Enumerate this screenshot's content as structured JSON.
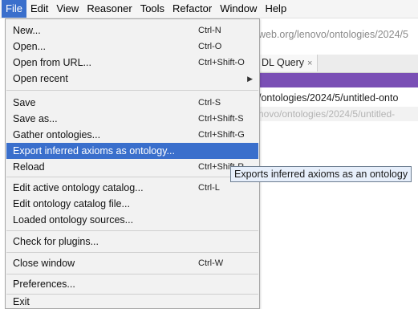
{
  "menubar": {
    "items": [
      "File",
      "Edit",
      "View",
      "Reasoner",
      "Tools",
      "Refactor",
      "Window",
      "Help"
    ]
  },
  "background": {
    "url_fragment": "web.org/lenovo/ontologies/2024/5",
    "tab_label": "DL Query",
    "tab_close": "×",
    "iri_text": "/ontologies/2024/5/untitled-onto",
    "iri_text_faded": "novo/ontologies/2024/5/untitled-"
  },
  "file_menu": {
    "new": {
      "label": "New...",
      "acc": "Ctrl-N"
    },
    "open": {
      "label": "Open...",
      "acc": "Ctrl-O"
    },
    "open_url": {
      "label": "Open from URL...",
      "acc": "Ctrl+Shift-O"
    },
    "open_recent": {
      "label": "Open recent"
    },
    "save": {
      "label": "Save",
      "acc": "Ctrl-S"
    },
    "save_as": {
      "label": "Save as...",
      "acc": "Ctrl+Shift-S"
    },
    "gather": {
      "label": "Gather ontologies...",
      "acc": "Ctrl+Shift-G"
    },
    "export_inferred": {
      "label": "Export inferred axioms as ontology..."
    },
    "reload": {
      "label": "Reload",
      "acc": "Ctrl+Shift-R"
    },
    "edit_catalog": {
      "label": "Edit active ontology catalog...",
      "acc": "Ctrl-L"
    },
    "edit_catalog_file": {
      "label": "Edit ontology catalog file..."
    },
    "loaded_sources": {
      "label": "Loaded ontology sources..."
    },
    "check_plugins": {
      "label": "Check for plugins..."
    },
    "close_window": {
      "label": "Close window",
      "acc": "Ctrl-W"
    },
    "preferences": {
      "label": "Preferences..."
    },
    "exit": {
      "label": "Exit"
    }
  },
  "tooltip": "Exports inferred axioms as an ontology",
  "colors": {
    "highlight": "#3a6fcc",
    "purple_bar": "#7a4fb5",
    "tooltip_bg": "#e7effb"
  }
}
